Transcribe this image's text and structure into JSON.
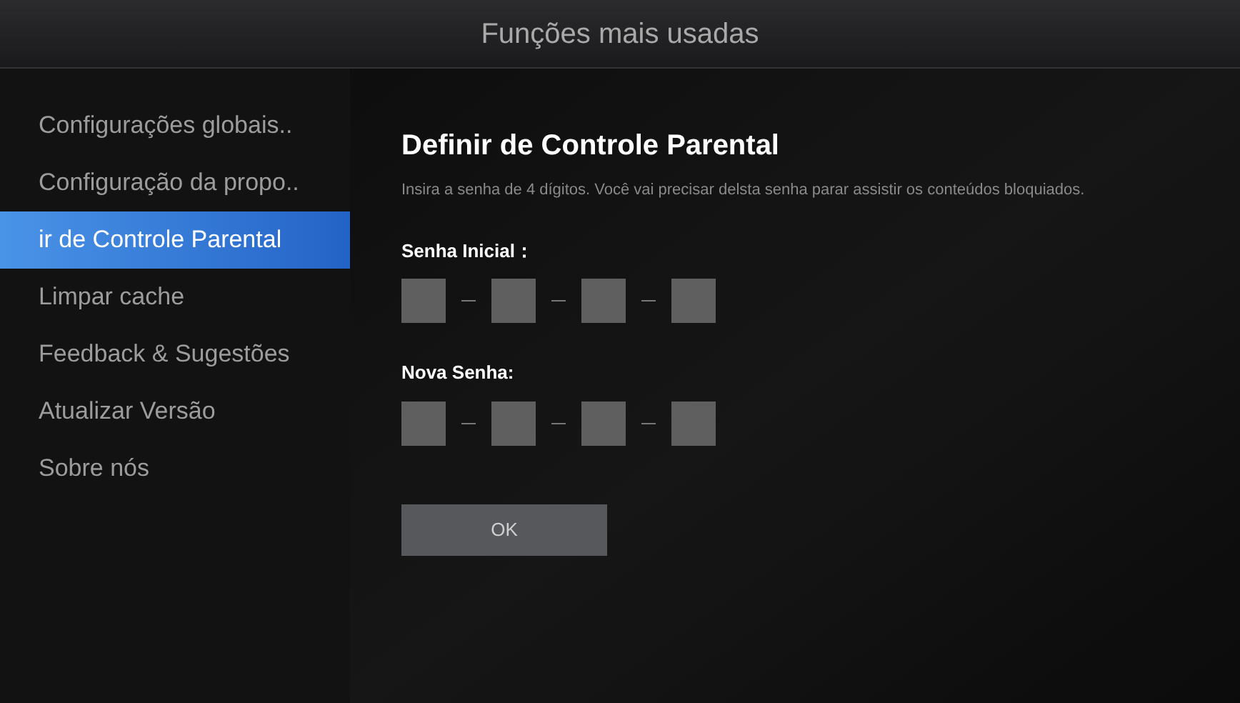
{
  "header": {
    "title": "Funções mais usadas"
  },
  "sidebar": {
    "items": [
      {
        "label": "Configurações globais..",
        "selected": false
      },
      {
        "label": "Configuração da propo..",
        "selected": false
      },
      {
        "label": "ir de Controle Parental",
        "selected": true
      },
      {
        "label": "Limpar cache",
        "selected": false
      },
      {
        "label": "Feedback & Sugestões",
        "selected": false
      },
      {
        "label": "Atualizar Versão",
        "selected": false
      },
      {
        "label": "Sobre nós",
        "selected": false
      }
    ]
  },
  "content": {
    "title": "Definir de Controle Parental",
    "description": "Insira a senha de 4 dígitos. Você vai precisar delsta senha parar assistir os conteúdos bloquiados.",
    "fields": [
      {
        "label": "Senha Inicial："
      },
      {
        "label": "Nova Senha:"
      }
    ],
    "button": "OK"
  }
}
